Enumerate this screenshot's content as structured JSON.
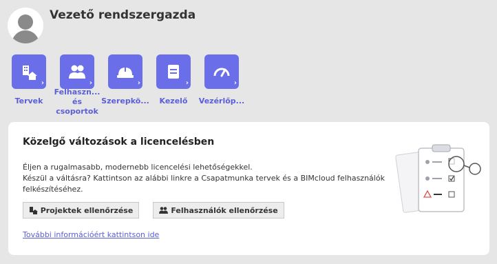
{
  "user": {
    "name": "Vezető rendszergazda"
  },
  "tiles": [
    {
      "label": "Tervek",
      "icon": "building-icon"
    },
    {
      "label": "Felhaszn... és csoportok",
      "icon": "users-icon"
    },
    {
      "label": "Szerepkö...",
      "icon": "hard-hat-icon"
    },
    {
      "label": "Kezelő",
      "icon": "server-icon"
    },
    {
      "label": "Vezérlőp...",
      "icon": "gauge-icon"
    }
  ],
  "card": {
    "title": "Közelgő változások a licencelésben",
    "line1": "Éljen a rugalmasabb, modernebb licencelési lehetőségekkel.",
    "line2": "Készül a váltásra? Kattintson az alábbi linkre a Csapatmunka tervek és a BIMcloud felhasználók felkészítéséhez.",
    "btn_projects": "Projektek ellenőrzése",
    "btn_users": "Felhasználók ellenőrzése",
    "more_link": "További információért kattintson ide"
  },
  "colors": {
    "accent": "#6a6ee8",
    "link": "#5b5fd6",
    "background": "#e6e6e6"
  }
}
